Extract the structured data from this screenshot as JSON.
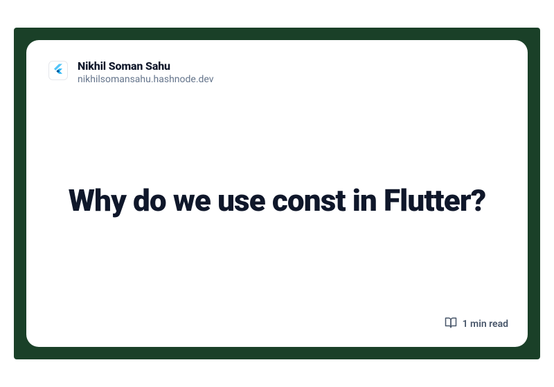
{
  "author": {
    "name": "Nikhil Soman Sahu",
    "domain": "nikhilsomansahu.hashnode.dev"
  },
  "post": {
    "title": "Why do we use const in Flutter?",
    "read_time": "1 min read"
  },
  "icons": {
    "avatar": "flutter-icon",
    "readtime": "book-open-icon"
  },
  "colors": {
    "frame": "#1a4028",
    "text_primary": "#0f172a",
    "text_secondary": "#64748b"
  }
}
